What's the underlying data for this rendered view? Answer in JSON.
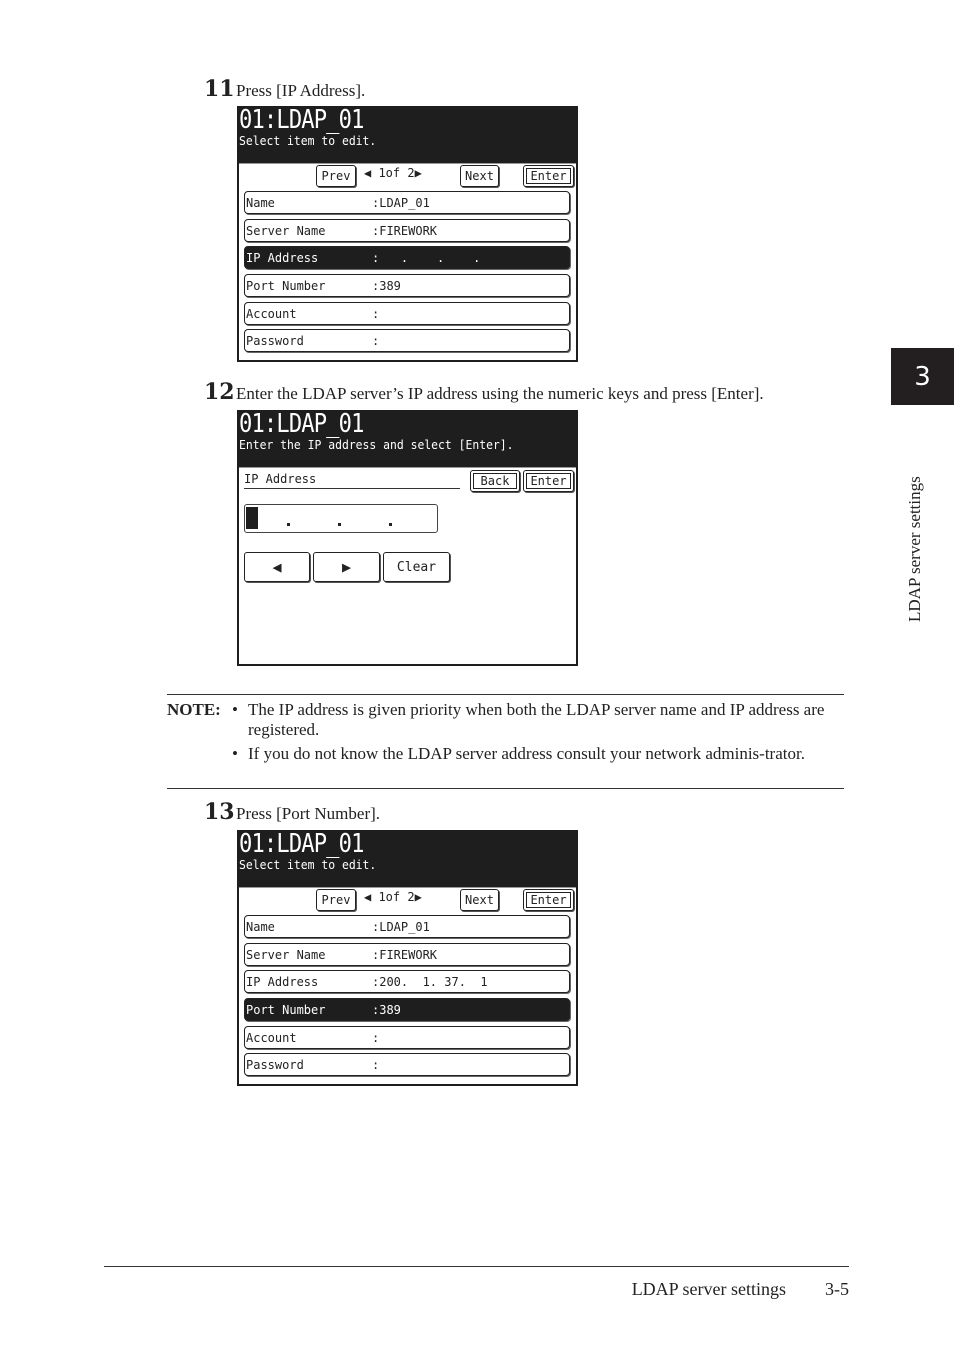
{
  "steps": [
    {
      "number": "11",
      "text": "Press [IP Address]."
    },
    {
      "number": "12",
      "text": "Enter the LDAP server’s IP address using the numeric keys and press [Enter]."
    },
    {
      "number": "13",
      "text": "Press [Port Number]."
    }
  ],
  "screen1": {
    "title": "01:LDAP_01",
    "subtitle": "Select item to edit.",
    "prev_label": "Prev",
    "next_label": "Next",
    "enter_label": "Enter",
    "pager": "1of  2",
    "rows": [
      {
        "label": "Name",
        "value": ":LDAP_01",
        "selected": false
      },
      {
        "label": "Server Name",
        "value": ":FIREWORK",
        "selected": false
      },
      {
        "label": "IP Address",
        "value": ":   .    .    .",
        "selected": true
      },
      {
        "label": "Port Number",
        "value": ":389",
        "selected": false
      },
      {
        "label": "Account",
        "value": ":",
        "selected": false
      },
      {
        "label": "Password",
        "value": ":",
        "selected": false
      }
    ]
  },
  "screen2": {
    "title": "01:LDAP_01",
    "subtitle": "Enter the IP address and select [Enter].",
    "field_label": "IP Address",
    "back_label": "Back",
    "enter_label": "Enter",
    "left_arrow": "◀",
    "right_arrow": "▶",
    "clear_label": "Clear",
    "ip_value": ".   .   ."
  },
  "note": {
    "label": "NOTE:",
    "items": [
      "The IP address is given priority when both the LDAP server name and IP address are registered.",
      "If you do not know the LDAP server address consult your network adminis-trator."
    ]
  },
  "screen3": {
    "title": "01:LDAP_01",
    "subtitle": "Select item to edit.",
    "prev_label": "Prev",
    "next_label": "Next",
    "enter_label": "Enter",
    "pager": "1of  2",
    "rows": [
      {
        "label": "Name",
        "value": ":LDAP_01",
        "selected": false
      },
      {
        "label": "Server Name",
        "value": ":FIREWORK",
        "selected": false
      },
      {
        "label": "IP Address",
        "value": ":200.  1. 37.  1",
        "selected": false
      },
      {
        "label": "Port Number",
        "value": ":389",
        "selected": true
      },
      {
        "label": "Account",
        "value": ":",
        "selected": false
      },
      {
        "label": "Password",
        "value": ":",
        "selected": false
      }
    ]
  },
  "side": {
    "chapter": "3",
    "label": "LDAP server settings"
  },
  "footer": {
    "title": "LDAP server settings",
    "page": "3-5"
  }
}
